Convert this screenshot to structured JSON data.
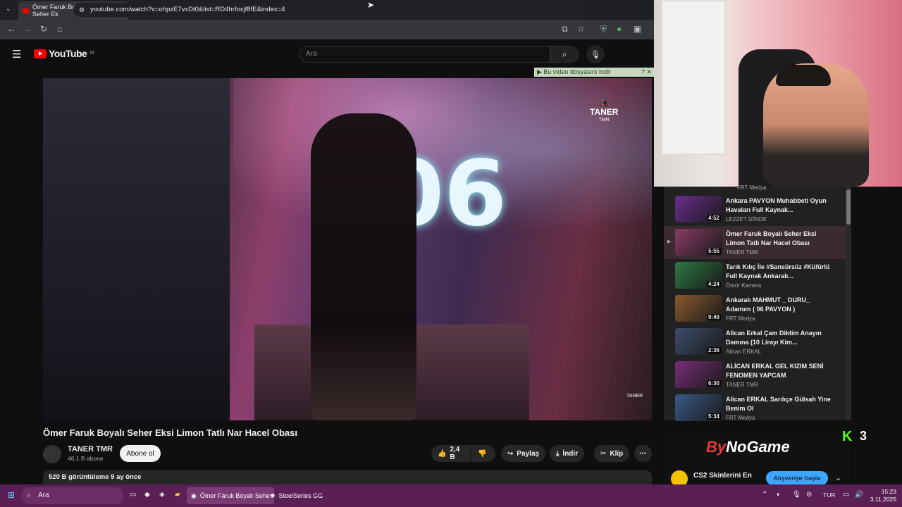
{
  "browser": {
    "tab_title": "Ömer Faruk Boyalı Seher Ek",
    "url": "youtube.com/watch?v=ohpzE7vxDt0&list=RD4hrfoxjf8fE&index=4"
  },
  "youtube": {
    "logo_text": "YouTube",
    "logo_country": "TR",
    "search_placeholder": "Ara",
    "download_bar": "Bu video dosyasını indir",
    "video": {
      "overlay_number": "06",
      "watermark": "TANER",
      "watermark_sub": "TMR",
      "watermark2": "TANER"
    },
    "title": "Ömer Faruk Boyalı Seher Eksi Limon Tatlı Nar Hacel Obası",
    "channel": "TANER TMR",
    "subscribers": "46,1 B abone",
    "subscribe_label": "Abone ol",
    "likes": "2,4 B",
    "share_label": "Paylaş",
    "download_label": "İndir",
    "clip_label": "Klip",
    "description_stats": "520 B görüntüleme  9 ay önce"
  },
  "playlist": {
    "top_partial_channel": "FRT Medya",
    "items": [
      {
        "title": "Ankara PAVYON Muhabbeti Oyun Havaları Full Kaynak...",
        "channel": "LEZZET İZİNDE",
        "duration": "4:52",
        "color": "#6a2d8f"
      },
      {
        "title": "Ömer Faruk Boyalı Seher Eksi Limon Tatlı Nar Hacel Obası",
        "channel": "TANER TMR",
        "duration": "5:55",
        "color": "#8a3b66"
      },
      {
        "title": "Tarık Kılıç İle #Sansürsüz #Küfürlü Full Kaynak Ankaralı...",
        "channel": "Ömür Kamera",
        "duration": "4:24",
        "color": "#2d7a43"
      },
      {
        "title": "Ankaralı MAHMUT _ DURU_ Adamım ( 06 PAVYON )",
        "channel": "FRT Medya",
        "duration": "9:49",
        "color": "#8a5a2d"
      },
      {
        "title": "Alican Erkal Çam Diktim Anayın Damına (10 Lirayı Kim...",
        "channel": "Alican ERKAL",
        "duration": "2:36",
        "color": "#3d4d6a"
      },
      {
        "title": "ALİCAN ERKAL GEL KIZIM SENİ FENOMEN YAPCAM",
        "channel": "TANER TMR",
        "duration": "6:30",
        "color": "#7a2d7a"
      },
      {
        "title": "Alican ERKAL Sarılıçe Gülsah Yine Benim Ol",
        "channel": "FRT Medya",
        "duration": "5:34",
        "color": "#3a5a8a"
      }
    ]
  },
  "ad": {
    "logo_prefix": "By",
    "logo_rest": "NoGame",
    "text": "CS2 Skinlerini En",
    "cta": "Alışverişe başla"
  },
  "overlay": {
    "kick_logo": "K",
    "kick_count": "3"
  },
  "taskbar": {
    "search": "Ara",
    "app1": "Ömer Faruk Boyalı Sehe",
    "app2": "SteelSeries GG",
    "lang": "TUR",
    "time": "15:23",
    "date": "3.11.2025"
  }
}
